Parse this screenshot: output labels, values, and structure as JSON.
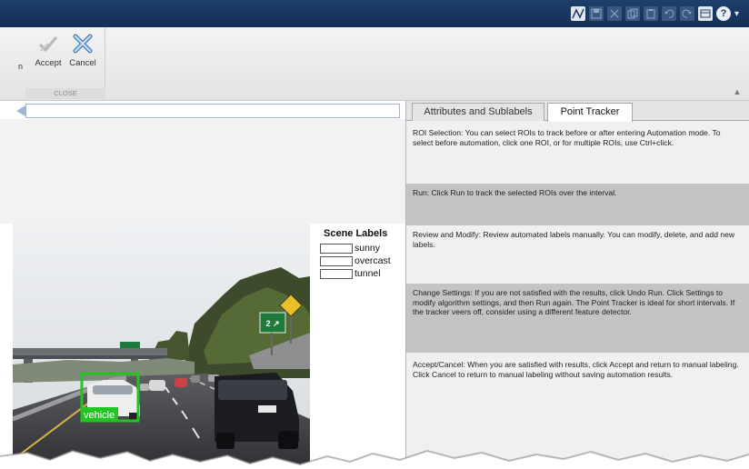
{
  "quick_access": {
    "icons": [
      "matlab-logo-icon",
      "save-icon",
      "cut-icon",
      "copy-icon",
      "paste-icon",
      "undo-icon",
      "redo-icon",
      "switch-windows-icon",
      "help-icon",
      "dropdown-icon"
    ],
    "help_glyph": "?",
    "dropdown_glyph": "▾"
  },
  "ribbon": {
    "left_stub": "n",
    "accept_label": "Accept",
    "cancel_label": "Cancel",
    "group_caption": "CLOSE"
  },
  "scene_labels": {
    "title": "Scene Labels",
    "items": [
      "sunny",
      "overcast",
      "tunnel"
    ]
  },
  "video": {
    "roi_label": "vehicle",
    "roi_color": "#22c422",
    "sign_text": "EXIT\n2"
  },
  "tabs": [
    {
      "label": "Attributes and Sublabels",
      "active": false
    },
    {
      "label": "Point Tracker",
      "active": true
    }
  ],
  "instructions": [
    "ROI Selection: You can select ROIs to track before or after entering Automation mode.  To select before automation, click one ROI, or for multiple ROIs, use Ctrl+click.",
    "Run: Click Run to track the selected ROIs over the interval.",
    "Review and Modify: Review automated labels manually. You can modify, delete, and add new labels.",
    "Change Settings: If you are not satisfied with the results, click Undo Run. Click Settings to modify algorithm settings, and then Run again. The Point Tracker is ideal for short intervals. If the tracker veers off, consider using a different feature detector.",
    "Accept/Cancel: When you are satisfied with results, click Accept and return to manual labeling. Click Cancel to return to manual labeling without saving automation results."
  ],
  "colors": {
    "titlebar": "#1a3a64",
    "ribbon": "#ececec",
    "alt_row": "#c4c4c4",
    "slider_border": "#9fb6d6"
  }
}
